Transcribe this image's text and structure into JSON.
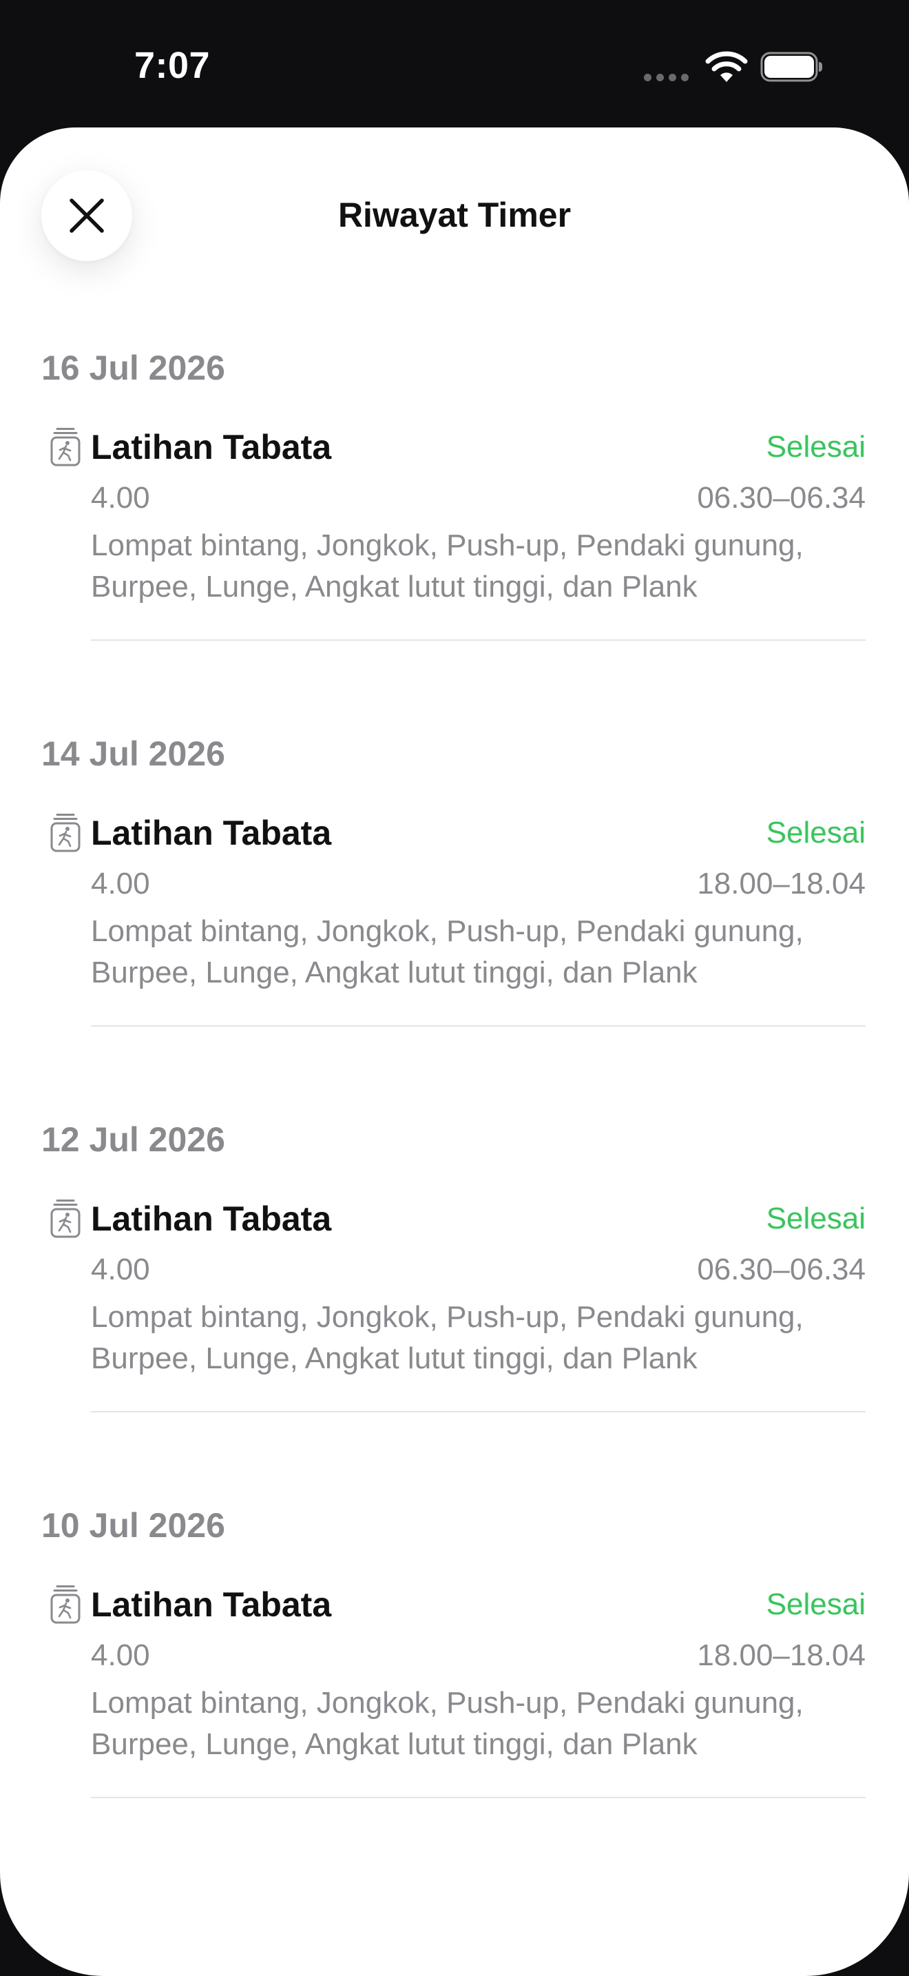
{
  "status_bar": {
    "time": "7:07"
  },
  "sheet": {
    "title": "Riwayat Timer"
  },
  "colors": {
    "status_green": "#34c759",
    "secondary_text": "#8a8a8e"
  },
  "icons": {
    "close": "close-icon",
    "entry": "exercise-timer-icon"
  },
  "sections": [
    {
      "date": "16 Jul 2026",
      "entry": {
        "title": "Latihan Tabata",
        "status": "Selesai",
        "duration": "4.00",
        "time_range": "06.30–06.34",
        "description": "Lompat bintang, Jongkok, Push-up, Pendaki gunung, Burpee, Lunge, Angkat lutut tinggi, dan Plank"
      }
    },
    {
      "date": "14 Jul 2026",
      "entry": {
        "title": "Latihan Tabata",
        "status": "Selesai",
        "duration": "4.00",
        "time_range": "18.00–18.04",
        "description": "Lompat bintang, Jongkok, Push-up, Pendaki gunung, Burpee, Lunge, Angkat lutut tinggi, dan Plank"
      }
    },
    {
      "date": "12 Jul 2026",
      "entry": {
        "title": "Latihan Tabata",
        "status": "Selesai",
        "duration": "4.00",
        "time_range": "06.30–06.34",
        "description": "Lompat bintang, Jongkok, Push-up, Pendaki gunung, Burpee, Lunge, Angkat lutut tinggi, dan Plank"
      }
    },
    {
      "date": "10 Jul 2026",
      "entry": {
        "title": "Latihan Tabata",
        "status": "Selesai",
        "duration": "4.00",
        "time_range": "18.00–18.04",
        "description": "Lompat bintang, Jongkok, Push-up, Pendaki gunung, Burpee, Lunge, Angkat lutut tinggi, dan Plank"
      }
    }
  ]
}
